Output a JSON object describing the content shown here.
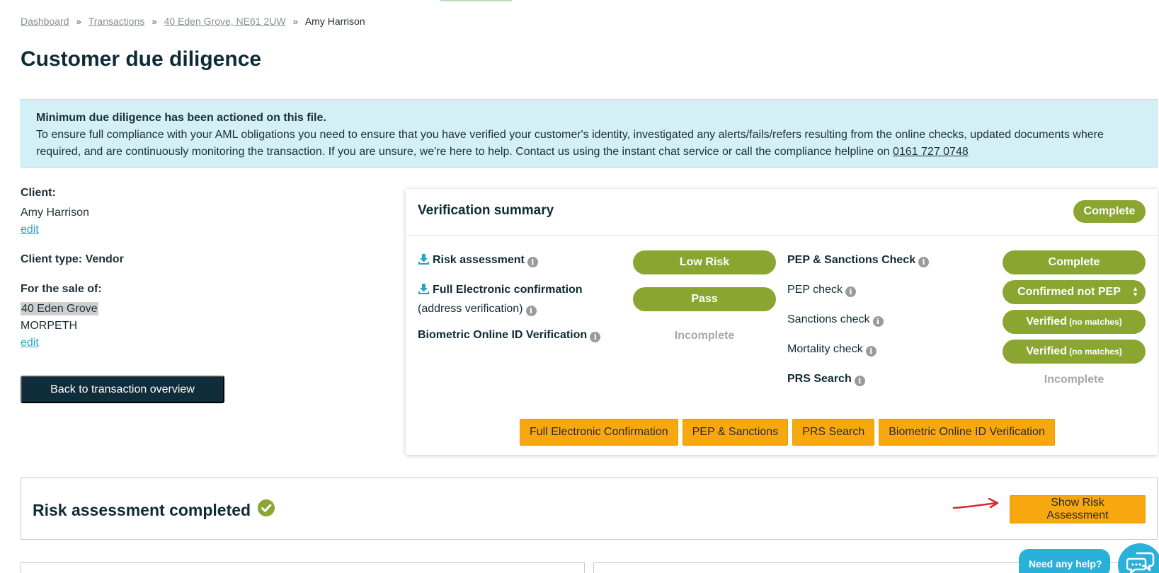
{
  "breadcrumb": {
    "items": [
      "Dashboard",
      "Transactions",
      "40 Eden Grove, NE61 2UW"
    ],
    "current": "Amy Harrison",
    "separator": "»"
  },
  "page_title": "Customer due diligence",
  "notice": {
    "heading": "Minimum due diligence has been actioned on this file.",
    "body": "To ensure full compliance with your AML obligations you need to ensure that you have verified your customer's identity, investigated any alerts/fails/refers resulting from the online checks, updated documents where required, and are continuously monitoring the transaction. If you are unsure, we're here to help. Contact us using the instant chat service or call the compliance helpline on",
    "phone": "0161 727 0748"
  },
  "client": {
    "label": "Client:",
    "name": "Amy Harrison",
    "edit": "edit",
    "type_label": "Client type: Vendor",
    "sale_label": "For the sale of:",
    "address_line1": "40 Eden Grove",
    "address_line2": "MORPETH",
    "address_edit": "edit"
  },
  "back_button": "Back to transaction overview",
  "verification": {
    "title": "Verification summary",
    "status": "Complete",
    "left_rows": [
      {
        "label": "Risk assessment",
        "status": "Low Risk"
      },
      {
        "label": "Full Electronic confirmation",
        "sublabel": "(address verification)",
        "status": "Pass"
      },
      {
        "label": "Biometric Online ID Verification",
        "status": "Incomplete"
      }
    ],
    "right_rows": [
      {
        "label": "PEP & Sanctions Check",
        "status": "Complete"
      },
      {
        "label": "PEP check",
        "status": "Confirmed not PEP"
      },
      {
        "label": "Sanctions check",
        "status": "Verified",
        "note": "(no matches)"
      },
      {
        "label": "Mortality check",
        "status": "Verified",
        "note": "(no matches)"
      },
      {
        "label": "PRS Search",
        "status": "Incomplete"
      }
    ],
    "buttons": [
      "Full Electronic Confirmation",
      "PEP & Sanctions",
      "PRS Search",
      "Biometric Online ID Verification"
    ]
  },
  "risk_assessment": {
    "title": "Risk assessment completed",
    "button": "Show Risk Assessment"
  },
  "help": {
    "label": "Need any help?"
  },
  "colors": {
    "navy": "#0f2d3a",
    "green": "#8aa631",
    "orange": "#f8a80f",
    "notice_bg": "#d3f0f6",
    "link": "#2ba3c7",
    "chat": "#2ab1da"
  }
}
